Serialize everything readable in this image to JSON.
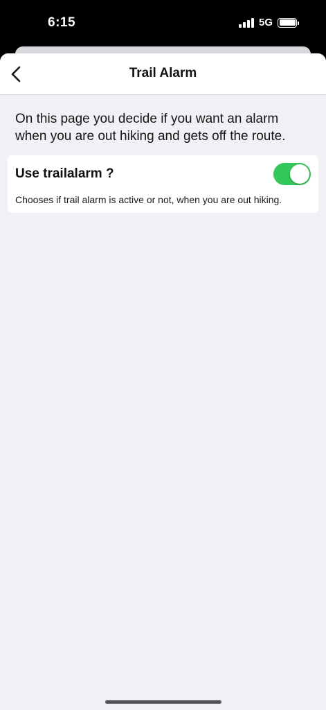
{
  "status_bar": {
    "time": "6:15",
    "network": "5G",
    "icons": [
      "signal-bars-icon",
      "battery-icon"
    ]
  },
  "nav": {
    "title": "Trail Alarm",
    "back_icon": "chevron-left-icon"
  },
  "page": {
    "description": "On this page you decide if you want an alarm when you are out hiking and gets off the route."
  },
  "settings": [
    {
      "title": "Use trailalarm ?",
      "subtitle": "Chooses if trail alarm is active or not, when you are out hiking.",
      "enabled": true
    }
  ],
  "colors": {
    "toggle_on": "#34c759",
    "background": "#f1f0f5",
    "card": "#ffffff"
  }
}
